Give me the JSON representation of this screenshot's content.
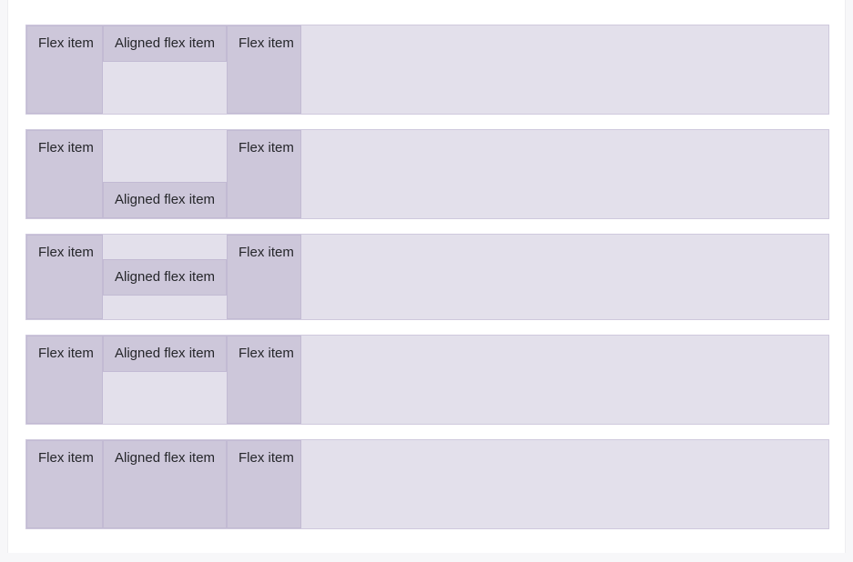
{
  "page": {
    "title": "align-self demo",
    "canvas_background": "#ffffff",
    "viewport_background": "#f7f7f9"
  },
  "colors": {
    "item_background": "#cdc7da",
    "item_border": "#c2bad3",
    "container_background": "#e3e0eb",
    "container_border": "#cfc9dd",
    "text": "#25262a"
  },
  "labels": {
    "flex_item": "Flex item",
    "aligned_flex_item": "Aligned flex item"
  },
  "containers": [
    {
      "name": "align-self-flex-start",
      "align_self": "flex-start",
      "items": [
        {
          "label": "Flex item",
          "role": "plain"
        },
        {
          "label": "Aligned flex item",
          "role": "aligned"
        },
        {
          "label": "Flex item",
          "role": "plain"
        }
      ]
    },
    {
      "name": "align-self-flex-end",
      "align_self": "flex-end",
      "items": [
        {
          "label": "Flex item",
          "role": "plain"
        },
        {
          "label": "Aligned flex item",
          "role": "aligned"
        },
        {
          "label": "Flex item",
          "role": "plain"
        }
      ]
    },
    {
      "name": "align-self-center",
      "align_self": "center",
      "items": [
        {
          "label": "Flex item",
          "role": "plain"
        },
        {
          "label": "Aligned flex item",
          "role": "aligned"
        },
        {
          "label": "Flex item",
          "role": "plain"
        }
      ]
    },
    {
      "name": "align-self-baseline",
      "align_self": "baseline",
      "items": [
        {
          "label": "Flex item",
          "role": "plain"
        },
        {
          "label": "Aligned flex item",
          "role": "aligned"
        },
        {
          "label": "Flex item",
          "role": "plain"
        }
      ]
    },
    {
      "name": "align-self-stretch",
      "align_self": "stretch",
      "items": [
        {
          "label": "Flex item",
          "role": "plain"
        },
        {
          "label": "Aligned flex item",
          "role": "aligned"
        },
        {
          "label": "Flex item",
          "role": "plain"
        }
      ]
    }
  ]
}
